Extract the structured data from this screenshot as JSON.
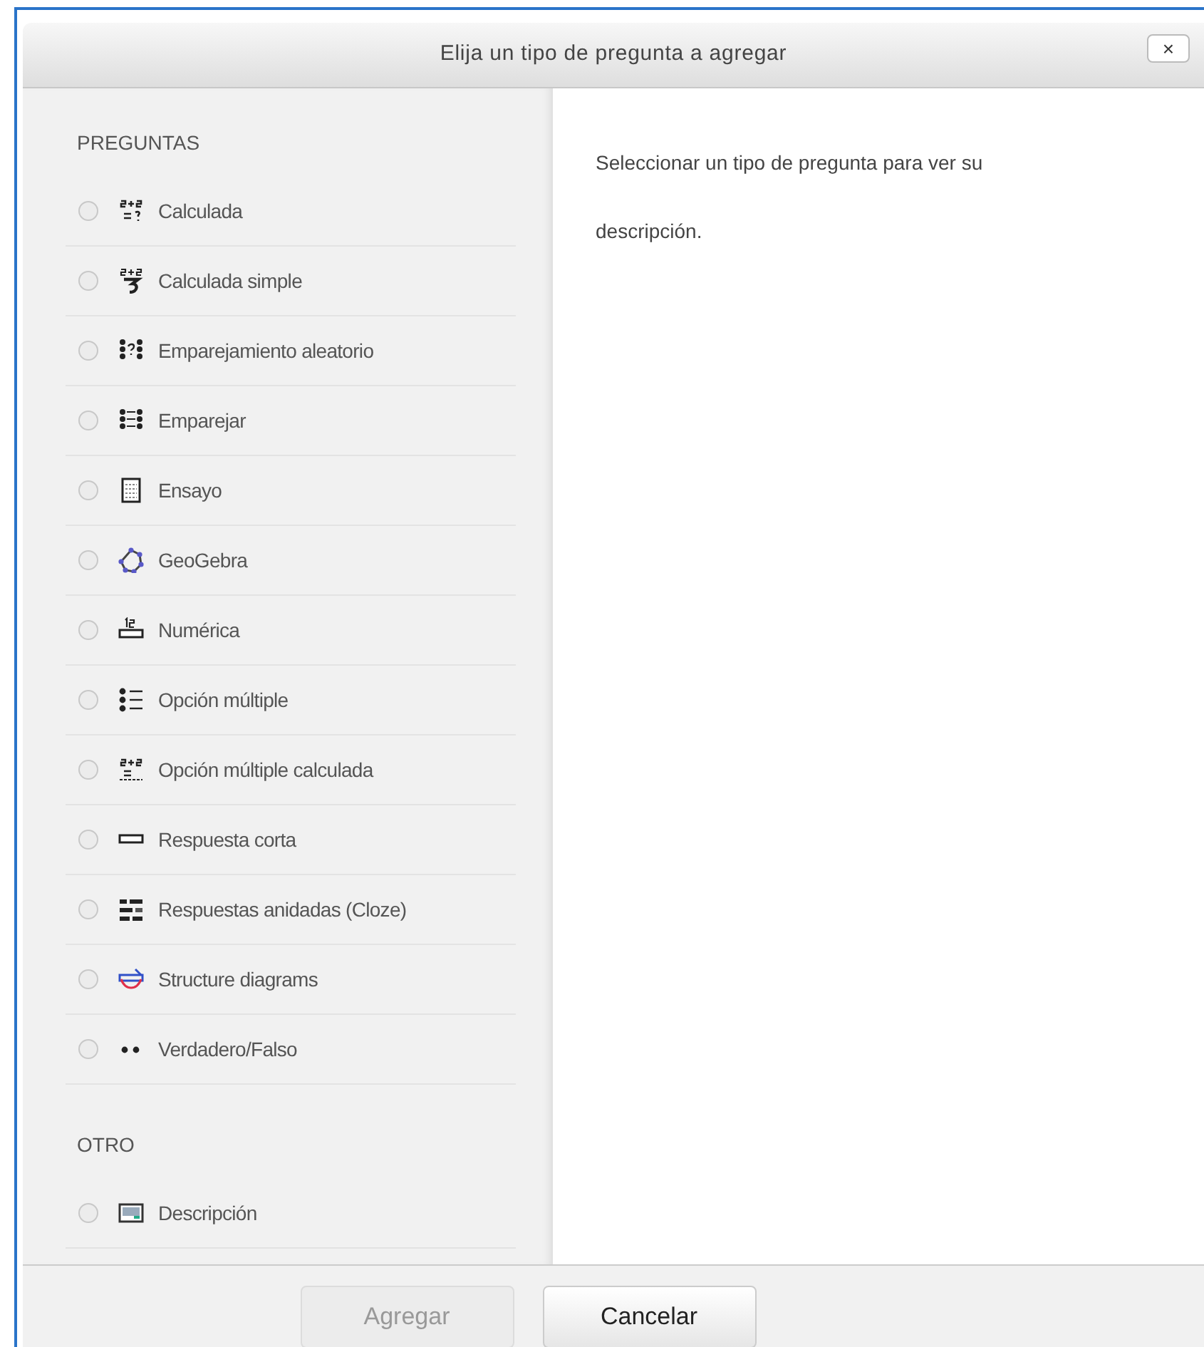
{
  "dialog": {
    "title": "Elija un tipo de pregunta a agregar",
    "close": "×"
  },
  "sections": [
    {
      "heading": "PREGUNTAS",
      "items": [
        {
          "label": "Calculada",
          "selected": false
        },
        {
          "label": "Calculada simple",
          "selected": false
        },
        {
          "label": "Emparejamiento aleatorio",
          "selected": false
        },
        {
          "label": "Emparejar",
          "selected": false
        },
        {
          "label": "Ensayo",
          "selected": false
        },
        {
          "label": "GeoGebra",
          "selected": false
        },
        {
          "label": "Numérica",
          "selected": false
        },
        {
          "label": "Opción múltiple",
          "selected": false
        },
        {
          "label": "Opción múltiple calculada",
          "selected": false
        },
        {
          "label": "Respuesta corta",
          "selected": false
        },
        {
          "label": "Respuestas anidadas (Cloze)",
          "selected": false
        },
        {
          "label": "Structure diagrams",
          "selected": false
        },
        {
          "label": "Verdadero/Falso",
          "selected": false
        }
      ]
    },
    {
      "heading": "OTRO",
      "items": [
        {
          "label": "Descripción",
          "selected": false
        }
      ]
    }
  ],
  "description": "Seleccionar un tipo de pregunta para ver su descripción.",
  "buttons": [
    {
      "label": "Agregar",
      "disabled": true
    },
    {
      "label": "Cancelar",
      "disabled": false
    }
  ]
}
